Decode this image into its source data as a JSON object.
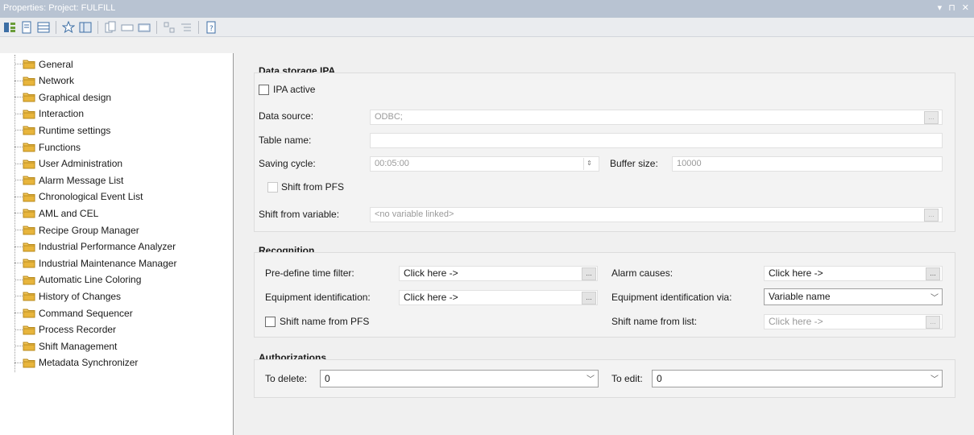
{
  "window": {
    "title": "Properties: Project: FULFILL",
    "controls": [
      "▾",
      "⊓",
      "✕"
    ]
  },
  "tree": {
    "items": [
      {
        "label": "General"
      },
      {
        "label": "Network"
      },
      {
        "label": "Graphical design"
      },
      {
        "label": "Interaction"
      },
      {
        "label": "Runtime settings"
      },
      {
        "label": "Functions"
      },
      {
        "label": "User Administration"
      },
      {
        "label": "Alarm Message List"
      },
      {
        "label": "Chronological Event List"
      },
      {
        "label": "AML and CEL"
      },
      {
        "label": "Recipe Group Manager"
      },
      {
        "label": "Industrial Performance Analyzer"
      },
      {
        "label": "Industrial Maintenance Manager"
      },
      {
        "label": "Automatic Line Coloring"
      },
      {
        "label": "History of Changes"
      },
      {
        "label": "Command Sequencer"
      },
      {
        "label": "Process Recorder"
      },
      {
        "label": "Shift Management"
      },
      {
        "label": "Metadata Synchronizer"
      }
    ],
    "selected_index": 11
  },
  "storage": {
    "title": "Data storage IPA",
    "ipa_active_label": "IPA active",
    "ipa_active_checked": false,
    "data_source_label": "Data source:",
    "data_source_value": "ODBC;",
    "table_name_label": "Table name:",
    "table_name_value": "",
    "saving_cycle_label": "Saving cycle:",
    "saving_cycle_value": "00:05:00",
    "buffer_size_label": "Buffer size:",
    "buffer_size_value": "10000",
    "shift_pfs_label": "Shift from PFS",
    "shift_variable_label": "Shift from variable:",
    "shift_variable_value": "<no variable linked>",
    "dots": "..."
  },
  "recognition": {
    "title": "Recognition",
    "time_filter_label": "Pre-define time filter:",
    "time_filter_value": "Click here ->",
    "alarm_causes_label": "Alarm causes:",
    "alarm_causes_value": "Click here ->",
    "equip_id_label": "Equipment identification:",
    "equip_id_value": "Click here ->",
    "equip_via_label": "Equipment identification via:",
    "equip_via_value": "Variable name",
    "shift_name_pfs_label": "Shift name from PFS",
    "shift_name_list_label": "Shift name from list:",
    "shift_name_list_value": "Click here ->",
    "dots": "..."
  },
  "authorizations": {
    "title": "Authorizations",
    "delete_label": "To delete:",
    "delete_value": "0",
    "edit_label": "To edit:",
    "edit_value": "0"
  },
  "colors": {
    "titlebar": "#b8c3d2",
    "folder": "#e8b53c",
    "panel": "#f0f0f0"
  }
}
